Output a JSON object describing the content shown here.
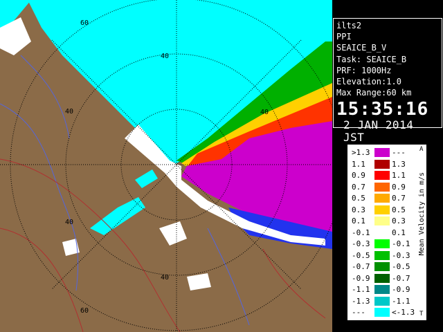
{
  "info": {
    "station": "ilts2",
    "scan_type": "PPI",
    "product": "SEAICE_B_V",
    "task": "Task: SEAICE_B",
    "prf": "PRF: 1000Hz",
    "elevation": "Elevation:1.0",
    "max_range": "Max Range:60 km",
    "time": "15:35:16",
    "date": "2 JAN 2014 JST"
  },
  "legend": {
    "title": "Mean Velocity in m/s",
    "top_marker": "A",
    "bottom_marker": "T",
    "rows": [
      {
        "low": ">1.3",
        "high": "---",
        "color": "#cc00cc"
      },
      {
        "low": "1.1",
        "high": "1.3",
        "color": "#b00000"
      },
      {
        "low": "0.9",
        "high": "1.1",
        "color": "#ff0000"
      },
      {
        "low": "0.7",
        "high": "0.9",
        "color": "#ff6600"
      },
      {
        "low": "0.5",
        "high": "0.7",
        "color": "#ffaa00"
      },
      {
        "low": "0.3",
        "high": "0.5",
        "color": "#ffd000"
      },
      {
        "low": "0.1",
        "high": "0.3",
        "color": "#ffff88"
      },
      {
        "low": "-0.1",
        "high": "0.1",
        "color": "#ffffff"
      },
      {
        "low": "-0.3",
        "high": "-0.1",
        "color": "#00ff00"
      },
      {
        "low": "-0.5",
        "high": "-0.3",
        "color": "#00c000"
      },
      {
        "low": "-0.7",
        "high": "-0.5",
        "color": "#009000"
      },
      {
        "low": "-0.9",
        "high": "-0.7",
        "color": "#006000"
      },
      {
        "low": "-1.1",
        "high": "-0.9",
        "color": "#008888"
      },
      {
        "low": "-1.3",
        "high": "-1.1",
        "color": "#00c8c8"
      },
      {
        "low": "---",
        "high": "<-1.3",
        "color": "#00ffff"
      }
    ]
  },
  "rings": {
    "labels": [
      "60",
      "40",
      "40",
      "40",
      "40",
      "60",
      "40"
    ]
  },
  "colors": {
    "land": "#8b6b48",
    "sea_approaching": "#00ffff",
    "sea_receding": "#cc00cc",
    "roads_blue": "#5566dd",
    "roads_red": "#b03030",
    "background": "#000000"
  }
}
